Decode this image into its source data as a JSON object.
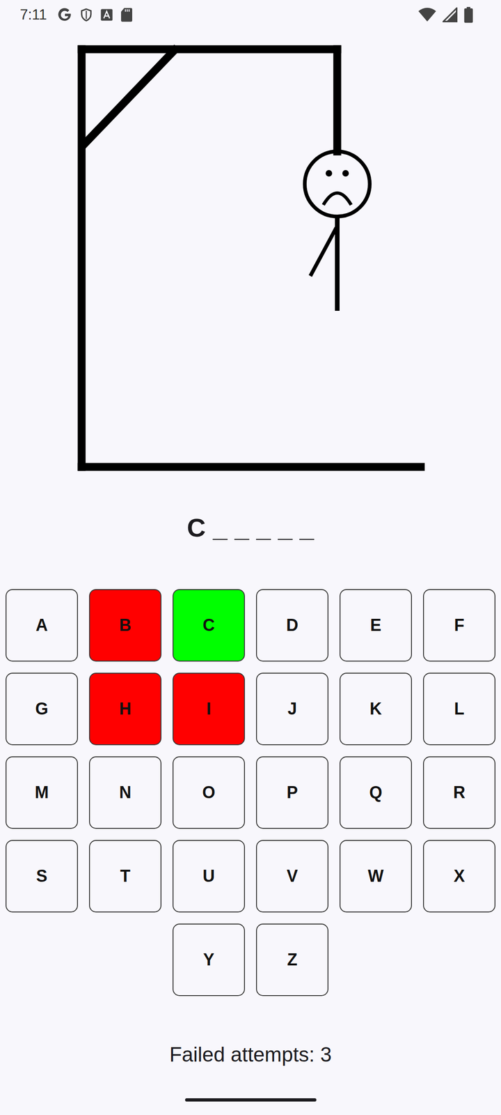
{
  "status_bar": {
    "time": "7:11"
  },
  "hangman": {
    "stage": 3
  },
  "word": "C _ _ _ _ _",
  "keys": [
    {
      "label": "A",
      "guessed": false,
      "correct": false
    },
    {
      "label": "B",
      "guessed": true,
      "correct": false
    },
    {
      "label": "C",
      "guessed": true,
      "correct": true
    },
    {
      "label": "D",
      "guessed": false,
      "correct": false
    },
    {
      "label": "E",
      "guessed": false,
      "correct": false
    },
    {
      "label": "F",
      "guessed": false,
      "correct": false
    },
    {
      "label": "G",
      "guessed": false,
      "correct": false
    },
    {
      "label": "H",
      "guessed": true,
      "correct": false
    },
    {
      "label": "I",
      "guessed": true,
      "correct": false
    },
    {
      "label": "J",
      "guessed": false,
      "correct": false
    },
    {
      "label": "K",
      "guessed": false,
      "correct": false
    },
    {
      "label": "L",
      "guessed": false,
      "correct": false
    },
    {
      "label": "M",
      "guessed": false,
      "correct": false
    },
    {
      "label": "N",
      "guessed": false,
      "correct": false
    },
    {
      "label": "O",
      "guessed": false,
      "correct": false
    },
    {
      "label": "P",
      "guessed": false,
      "correct": false
    },
    {
      "label": "Q",
      "guessed": false,
      "correct": false
    },
    {
      "label": "R",
      "guessed": false,
      "correct": false
    },
    {
      "label": "S",
      "guessed": false,
      "correct": false
    },
    {
      "label": "T",
      "guessed": false,
      "correct": false
    },
    {
      "label": "U",
      "guessed": false,
      "correct": false
    },
    {
      "label": "V",
      "guessed": false,
      "correct": false
    },
    {
      "label": "W",
      "guessed": false,
      "correct": false
    },
    {
      "label": "X",
      "guessed": false,
      "correct": false
    },
    {
      "label": "Y",
      "guessed": false,
      "correct": false
    },
    {
      "label": "Z",
      "guessed": false,
      "correct": false
    }
  ],
  "failed_attempts": "Failed attempts: 3"
}
